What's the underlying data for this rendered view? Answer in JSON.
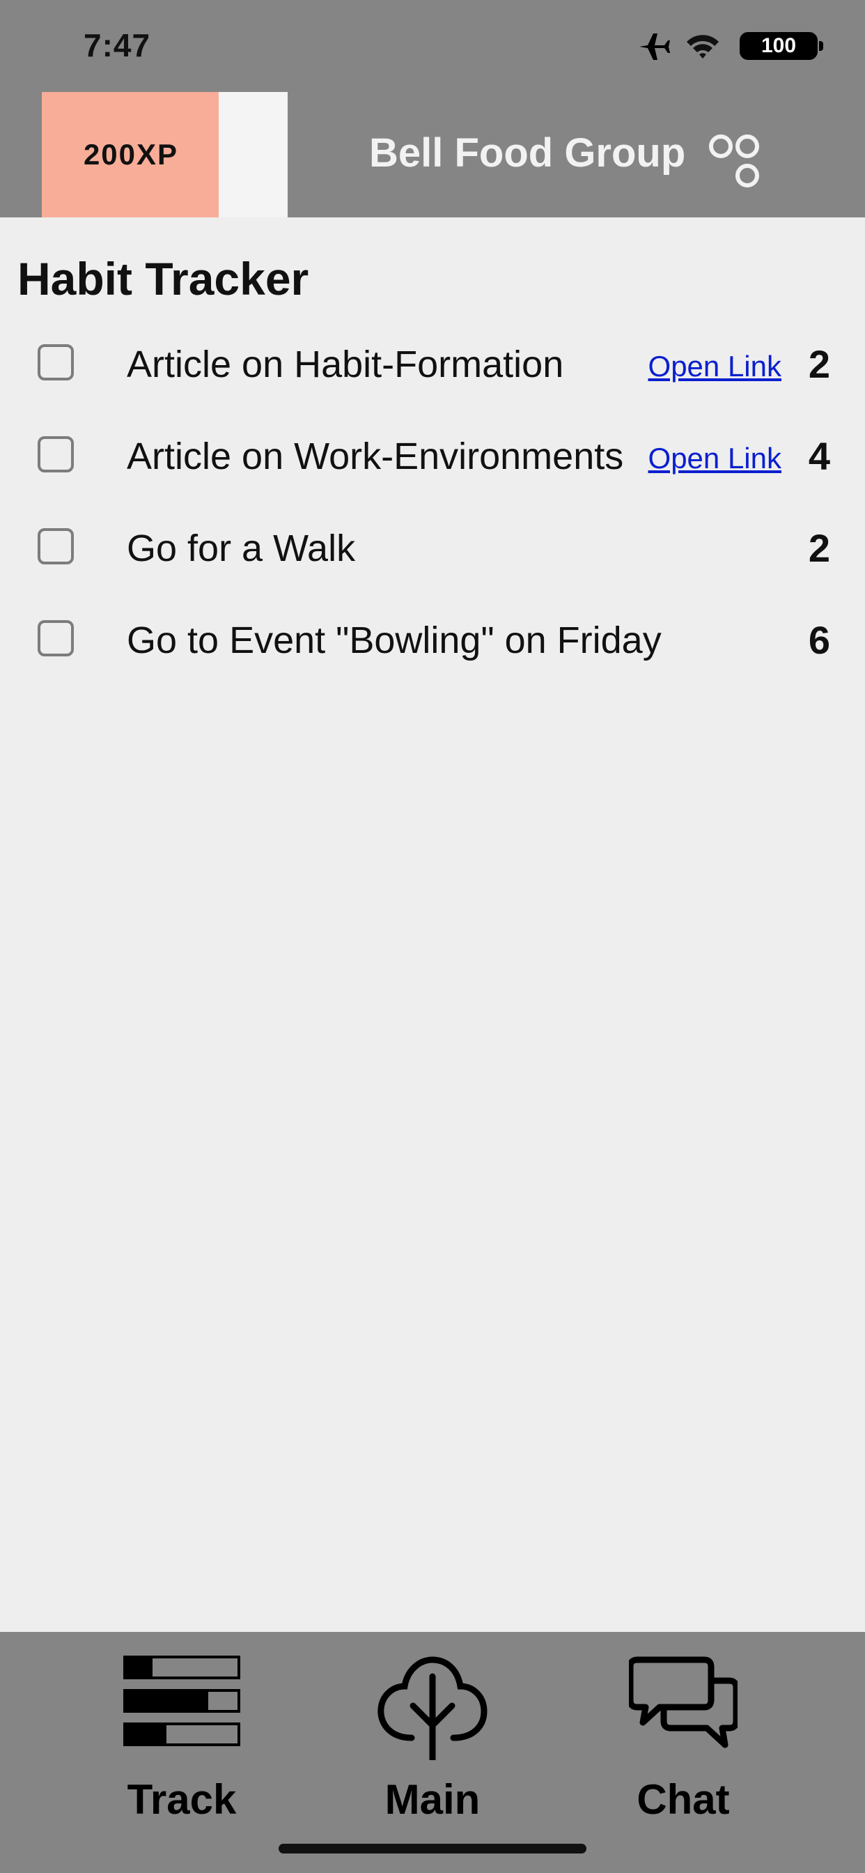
{
  "status_bar": {
    "time": "7:47",
    "battery": "100",
    "icons": [
      "airplane-icon",
      "wifi-icon",
      "battery-icon"
    ]
  },
  "header": {
    "xp_label": "200XP",
    "xp_progress": 0.72,
    "company_name": "Bell Food Group",
    "logo_icon": "company-logo-icon"
  },
  "main": {
    "title": "Habit Tracker",
    "habits": [
      {
        "label": "Article on Habit-Formation",
        "link": "Open Link",
        "points": "2",
        "checked": false
      },
      {
        "label": "Article on Work-Environments",
        "link": "Open Link",
        "points": "4",
        "checked": false
      },
      {
        "label": "Go for a Walk",
        "link": "",
        "points": "2",
        "checked": false
      },
      {
        "label": "Go to Event \"Bowling\" on Friday",
        "link": "",
        "points": "6",
        "checked": false
      }
    ]
  },
  "bottom_nav": {
    "items": [
      {
        "label": "Track",
        "icon": "track-icon"
      },
      {
        "label": "Main",
        "icon": "tree-icon"
      },
      {
        "label": "Chat",
        "icon": "chat-icon"
      }
    ]
  },
  "colors": {
    "bar_bg": "#858585",
    "page_bg": "#eeeeee",
    "xp_fill": "#f7ad98",
    "link": "#0a1fcf"
  }
}
